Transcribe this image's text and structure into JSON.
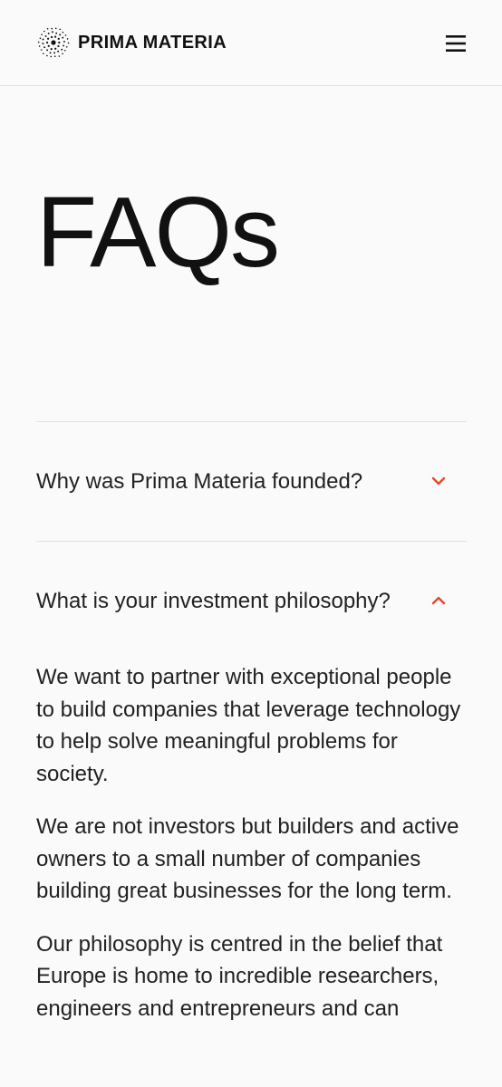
{
  "header": {
    "brand_name": "PRIMA MATERIA",
    "logo_icon": "starburst-dot-logo-icon",
    "menu_icon": "hamburger-menu-icon"
  },
  "page": {
    "title": "FAQs"
  },
  "faq": {
    "accent_color": "#e8472a",
    "items": [
      {
        "question": "Why was Prima Materia founded?",
        "expanded": false,
        "icon": "chevron-down-icon"
      },
      {
        "question": "What is your investment philosophy?",
        "expanded": true,
        "icon": "chevron-up-icon",
        "answer": [
          "We want to partner with exceptional people to build companies that leverage technology to help solve meaningful problems for society.",
          "We are not investors but builders and active owners to a small number of companies building great businesses for the long term.",
          "Our philosophy is centred in the belief that Europe is home to incredible researchers, engineers and entrepreneurs and can"
        ]
      }
    ]
  }
}
